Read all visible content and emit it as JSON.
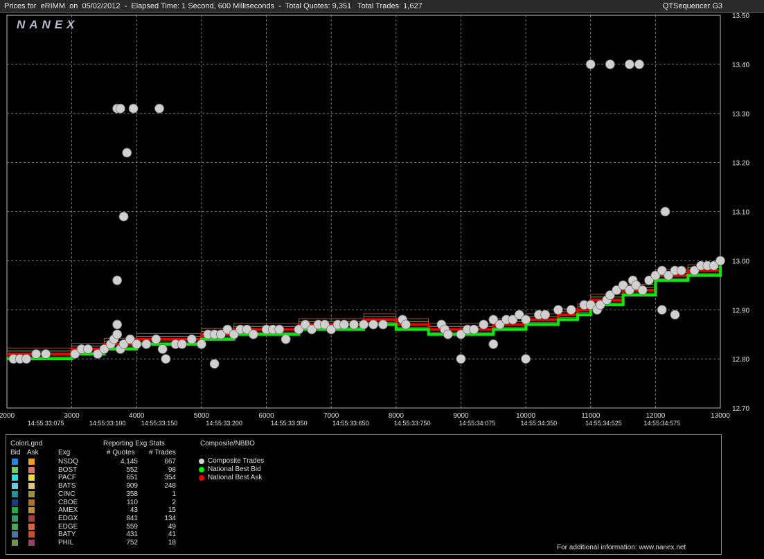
{
  "header": {
    "title": "Prices for  eRIMM  on  05/02/2012  -  Elapsed Time: 1 Second, 600 Milliseconds  -  Total Quotes: 9,351   Total Trades: 1,627",
    "app": "QTSequencer G3",
    "logo": "NANEX"
  },
  "chart_data": {
    "type": "line",
    "xlim": [
      2000,
      13000
    ],
    "ylim": [
      12.7,
      13.5
    ],
    "x_ticks": [
      2000,
      3000,
      4000,
      5000,
      6000,
      7000,
      8000,
      9000,
      10000,
      11000,
      12000,
      13000
    ],
    "y_ticks": [
      "12.70",
      "12.80",
      "12.90",
      "13.00",
      "13.10",
      "13.20",
      "13.30",
      "13.40",
      "13.50"
    ],
    "time_labels": [
      {
        "x": 2600,
        "t": "14:55:33:075"
      },
      {
        "x": 3550,
        "t": "14:55:33:100"
      },
      {
        "x": 4350,
        "t": "14:55:33:150"
      },
      {
        "x": 5350,
        "t": "14:55:33:200"
      },
      {
        "x": 6350,
        "t": "14:55:33:350"
      },
      {
        "x": 7300,
        "t": "14:55:33:650"
      },
      {
        "x": 8250,
        "t": "14:55:33:750"
      },
      {
        "x": 9250,
        "t": "14:55:34:075"
      },
      {
        "x": 10200,
        "t": "14:55:34:350"
      },
      {
        "x": 11200,
        "t": "14:55:34:525"
      },
      {
        "x": 12100,
        "t": "14:55:34:575"
      }
    ],
    "grid": true,
    "series": [
      {
        "name": "National Best Bid",
        "color": "#00ee00",
        "x": [
          2000,
          2500,
          3000,
          3500,
          4000,
          4500,
          5000,
          5500,
          6000,
          6500,
          7000,
          7500,
          8000,
          8500,
          9000,
          9500,
          10000,
          10500,
          10800,
          11000,
          11500,
          12000,
          12500,
          13000
        ],
        "y": [
          12.8,
          12.8,
          12.81,
          12.82,
          12.83,
          12.83,
          12.84,
          12.85,
          12.85,
          12.86,
          12.86,
          12.87,
          12.86,
          12.85,
          12.85,
          12.86,
          12.87,
          12.88,
          12.89,
          12.91,
          12.93,
          12.96,
          12.97,
          12.99
        ]
      },
      {
        "name": "National Best Ask",
        "color": "#ee0000",
        "x": [
          2000,
          2500,
          3000,
          3500,
          4000,
          4500,
          5000,
          5500,
          6000,
          6500,
          7000,
          7500,
          8000,
          8500,
          9000,
          9500,
          10000,
          10500,
          10800,
          11000,
          11500,
          12000,
          12500,
          13000
        ],
        "y": [
          12.81,
          12.81,
          12.82,
          12.83,
          12.84,
          12.84,
          12.85,
          12.86,
          12.86,
          12.87,
          12.87,
          12.88,
          12.87,
          12.86,
          12.86,
          12.87,
          12.88,
          12.89,
          12.9,
          12.92,
          12.94,
          12.97,
          12.98,
          13.0
        ]
      }
    ],
    "trades": {
      "name": "Composite Trades",
      "color": "#d0d0d0",
      "x": [
        2100,
        2200,
        2300,
        2450,
        2600,
        3050,
        3150,
        3250,
        3400,
        3500,
        3600,
        3650,
        3700,
        3750,
        3800,
        3900,
        4000,
        4150,
        4300,
        4400,
        4600,
        4700,
        4850,
        5000,
        5100,
        5200,
        5300,
        5400,
        5500,
        5600,
        5700,
        5800,
        6000,
        6100,
        6200,
        6300,
        6500,
        6600,
        6700,
        6800,
        6900,
        7000,
        7100,
        7200,
        7350,
        7500,
        7650,
        7800,
        8100,
        8150,
        8700,
        8750,
        8800,
        9000,
        9100,
        9200,
        9350,
        9500,
        9600,
        9700,
        9800,
        9900,
        10000,
        10200,
        10300,
        10500,
        10700,
        10900,
        11000,
        11100,
        11150,
        11250,
        11300,
        11400,
        11500,
        11600,
        11650,
        11700,
        11800,
        11900,
        12000,
        12100,
        12200,
        12300,
        12400,
        12600,
        12700,
        12800,
        12900,
        13000,
        3700,
        3750,
        3950,
        4350,
        3850,
        3700,
        3800,
        3700,
        4450,
        5200,
        9000,
        9500,
        10000,
        12100,
        12300,
        11000,
        11300,
        11600,
        11750,
        12150
      ],
      "y": [
        12.8,
        12.8,
        12.8,
        12.81,
        12.81,
        12.81,
        12.82,
        12.82,
        12.81,
        12.82,
        12.83,
        12.84,
        12.85,
        12.82,
        12.83,
        12.84,
        12.83,
        12.83,
        12.84,
        12.82,
        12.83,
        12.83,
        12.84,
        12.83,
        12.85,
        12.85,
        12.85,
        12.86,
        12.85,
        12.86,
        12.86,
        12.85,
        12.86,
        12.86,
        12.86,
        12.84,
        12.86,
        12.87,
        12.86,
        12.87,
        12.87,
        12.86,
        12.87,
        12.87,
        12.87,
        12.87,
        12.87,
        12.87,
        12.88,
        12.87,
        12.87,
        12.86,
        12.85,
        12.85,
        12.86,
        12.86,
        12.87,
        12.88,
        12.87,
        12.88,
        12.88,
        12.89,
        12.88,
        12.89,
        12.89,
        12.9,
        12.9,
        12.91,
        12.91,
        12.9,
        12.91,
        12.92,
        12.93,
        12.94,
        12.95,
        12.94,
        12.96,
        12.95,
        12.94,
        12.96,
        12.97,
        12.98,
        12.97,
        12.98,
        12.98,
        12.98,
        12.99,
        12.99,
        12.99,
        13.0,
        13.31,
        13.31,
        13.31,
        13.31,
        13.22,
        12.96,
        13.09,
        12.87,
        12.8,
        12.79,
        12.8,
        12.83,
        12.8,
        12.9,
        12.89,
        13.4,
        13.4,
        13.4,
        13.4,
        13.1
      ]
    }
  },
  "legend": {
    "color_legend_label": "ColorLgnd",
    "bid_label": "Bid",
    "ask_label": "Ask",
    "exg_label": "Exg",
    "stats_title": "Reporting Exg Stats",
    "quotes_header": "# Quotes",
    "trades_header": "# Trades",
    "composite_title": "Composite/NBBO",
    "exchanges": [
      {
        "name": "NSDQ",
        "quotes": "4,145",
        "trades": "667",
        "bid_color": "#1e88e5",
        "ask_color": "#f39c12"
      },
      {
        "name": "BOST",
        "quotes": "552",
        "trades": "98",
        "bid_color": "#66cc66",
        "ask_color": "#e07070"
      },
      {
        "name": "PACF",
        "quotes": "651",
        "trades": "354",
        "bid_color": "#22e0e0",
        "ask_color": "#f0e020"
      },
      {
        "name": "BATS",
        "quotes": "909",
        "trades": "248",
        "bid_color": "#66ccee",
        "ask_color": "#f0c070"
      },
      {
        "name": "CINC",
        "quotes": "358",
        "trades": "1",
        "bid_color": "#119999",
        "ask_color": "#a09030"
      },
      {
        "name": "CBOE",
        "quotes": "110",
        "trades": "2",
        "bid_color": "#1a3a9a",
        "ask_color": "#b07020"
      },
      {
        "name": "AMEX",
        "quotes": "43",
        "trades": "15",
        "bid_color": "#22aa44",
        "ask_color": "#c09030"
      },
      {
        "name": "EDGX",
        "quotes": "841",
        "trades": "134",
        "bid_color": "#339966",
        "ask_color": "#a04040"
      },
      {
        "name": "EDGE",
        "quotes": "559",
        "trades": "49",
        "bid_color": "#44aa55",
        "ask_color": "#e06040"
      },
      {
        "name": "BATY",
        "quotes": "431",
        "trades": "41",
        "bid_color": "#4477aa",
        "ask_color": "#dd4422"
      },
      {
        "name": "PHIL",
        "quotes": "752",
        "trades": "18",
        "bid_color": "#669944",
        "ask_color": "#a04060"
      }
    ],
    "composite": [
      {
        "label": "Composite Trades",
        "color": "#d0d0d0"
      },
      {
        "label": "National Best Bid",
        "color": "#00ee00"
      },
      {
        "label": "National Best Ask",
        "color": "#ee0000"
      }
    ],
    "footer": "For additional information: www.nanex.net"
  }
}
